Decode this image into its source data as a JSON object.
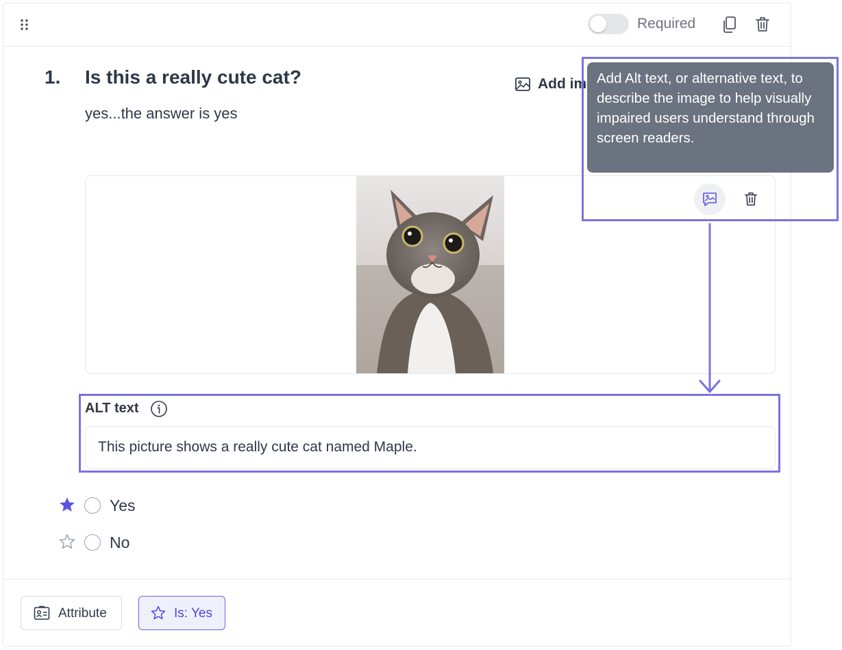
{
  "header": {
    "required_label": "Required",
    "required_on": false
  },
  "question": {
    "number": "1.",
    "title": "Is this a really cute cat?",
    "description": "yes...the answer is yes",
    "add_image_label": "Add image"
  },
  "image": {
    "subject": "photo of a tabby kitten"
  },
  "tooltip": {
    "text": "Add Alt text, or alternative text, to describe the image to help visually impaired users understand through screen readers."
  },
  "alt": {
    "label": "ALT text",
    "value": "This picture shows a really cute cat named Maple."
  },
  "options": [
    {
      "label": "Yes",
      "starred": true
    },
    {
      "label": "No",
      "starred": false
    }
  ],
  "footer": {
    "attribute_label": "Attribute",
    "is_label": "Is: Yes"
  },
  "colors": {
    "accent": "#6b63e0",
    "text": "#2f3747",
    "tooltip_bg": "#6b7280"
  }
}
